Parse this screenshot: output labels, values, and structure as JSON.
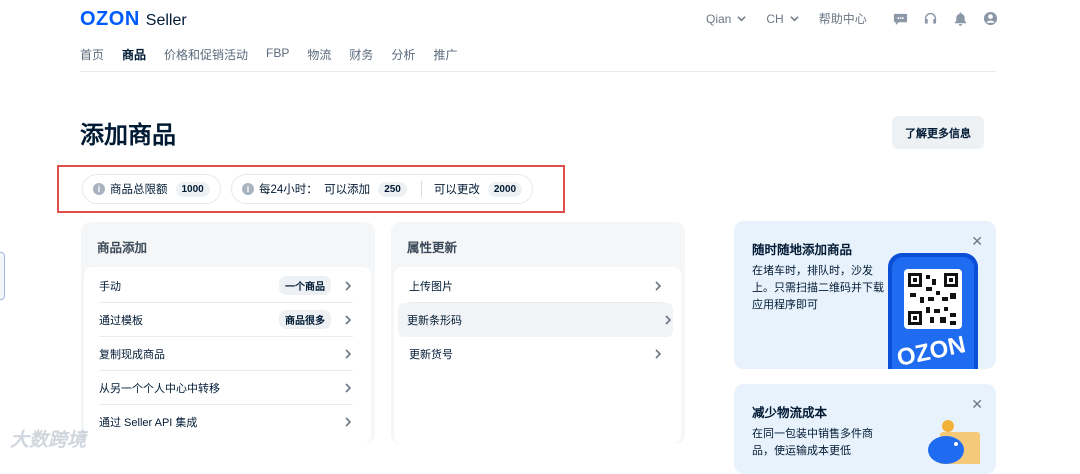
{
  "header": {
    "brand": "OZON",
    "product": "Seller",
    "user_menu": "Qian",
    "language_menu": "CH",
    "help_center": "帮助中心"
  },
  "nav": [
    "首页",
    "商品",
    "价格和促销活动",
    "FBP",
    "物流",
    "财务",
    "分析",
    "推广"
  ],
  "nav_active": "商品",
  "page": {
    "title": "添加商品",
    "learn_more": "了解更多信息"
  },
  "limits": {
    "total_label": "商品总限额",
    "total_value": "1000",
    "daily_label": "每24小时：  可以添加",
    "daily_add_value": "250",
    "daily_edit_label": "可以更改",
    "daily_edit_value": "2000"
  },
  "product_add": {
    "heading": "商品添加",
    "rows": [
      {
        "label": "手动",
        "tag": "一个商品"
      },
      {
        "label": "通过模板",
        "tag": "商品很多"
      },
      {
        "label": "复制现成商品"
      },
      {
        "label": "从另一个个人中心中转移"
      },
      {
        "label": "通过 Seller API 集成"
      }
    ]
  },
  "attr_update": {
    "heading": "属性更新",
    "rows": [
      {
        "label": "上传图片"
      },
      {
        "label": "更新条形码"
      },
      {
        "label": "更新货号"
      }
    ]
  },
  "promo1": {
    "title": "随时随地添加商品",
    "text": "在堵车时，排队时，沙发上。只需扫描二维码并下载应用程序即可",
    "phone_brand": "OZON"
  },
  "promo2": {
    "title": "减少物流成本",
    "text": "在同一包装中销售多件商品，使运输成本更低"
  },
  "watermark": "大数跨境",
  "colors": {
    "brand": "#005bff",
    "highlight_border": "#e04e4e",
    "promo_bg": "#e8f2fc"
  }
}
